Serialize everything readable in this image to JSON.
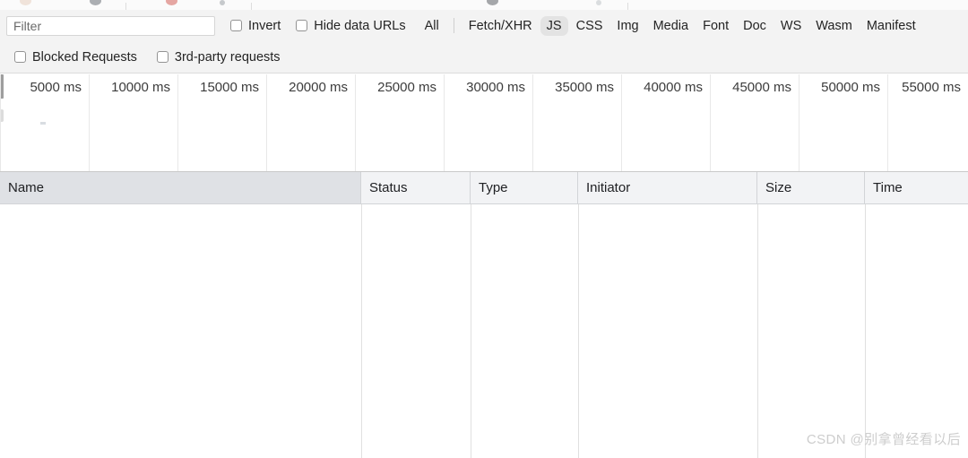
{
  "toolbar": {
    "filter": {
      "placeholder": "Filter",
      "value": ""
    },
    "checkboxes": [
      {
        "label": "Invert",
        "checked": false
      },
      {
        "label": "Hide data URLs",
        "checked": false
      }
    ],
    "resource_types": [
      {
        "label": "All",
        "selected": false
      },
      {
        "label": "Fetch/XHR",
        "selected": false
      },
      {
        "label": "JS",
        "selected": true
      },
      {
        "label": "CSS",
        "selected": false
      },
      {
        "label": "Img",
        "selected": false
      },
      {
        "label": "Media",
        "selected": false
      },
      {
        "label": "Font",
        "selected": false
      },
      {
        "label": "Doc",
        "selected": false
      },
      {
        "label": "WS",
        "selected": false
      },
      {
        "label": "Wasm",
        "selected": false
      },
      {
        "label": "Manifest",
        "selected": false
      }
    ],
    "selected_color": "#e3e3e3"
  },
  "toolbar2": {
    "checkboxes": [
      {
        "label": "Blocked Requests",
        "checked": false
      },
      {
        "label": "3rd-party requests",
        "checked": false
      }
    ]
  },
  "overview": {
    "ticks": [
      "5000 ms",
      "10000 ms",
      "15000 ms",
      "20000 ms",
      "25000 ms",
      "30000 ms",
      "35000 ms",
      "40000 ms",
      "45000 ms",
      "50000 ms",
      "55000 ms"
    ]
  },
  "table": {
    "columns": [
      {
        "label": "Name",
        "sorted": true
      },
      {
        "label": "Status",
        "sorted": false
      },
      {
        "label": "Type",
        "sorted": false
      },
      {
        "label": "Initiator",
        "sorted": false
      },
      {
        "label": "Size",
        "sorted": false
      },
      {
        "label": "Time",
        "sorted": false
      }
    ],
    "rows": []
  },
  "watermark": {
    "text": "CSDN @别拿曾经看以后"
  }
}
